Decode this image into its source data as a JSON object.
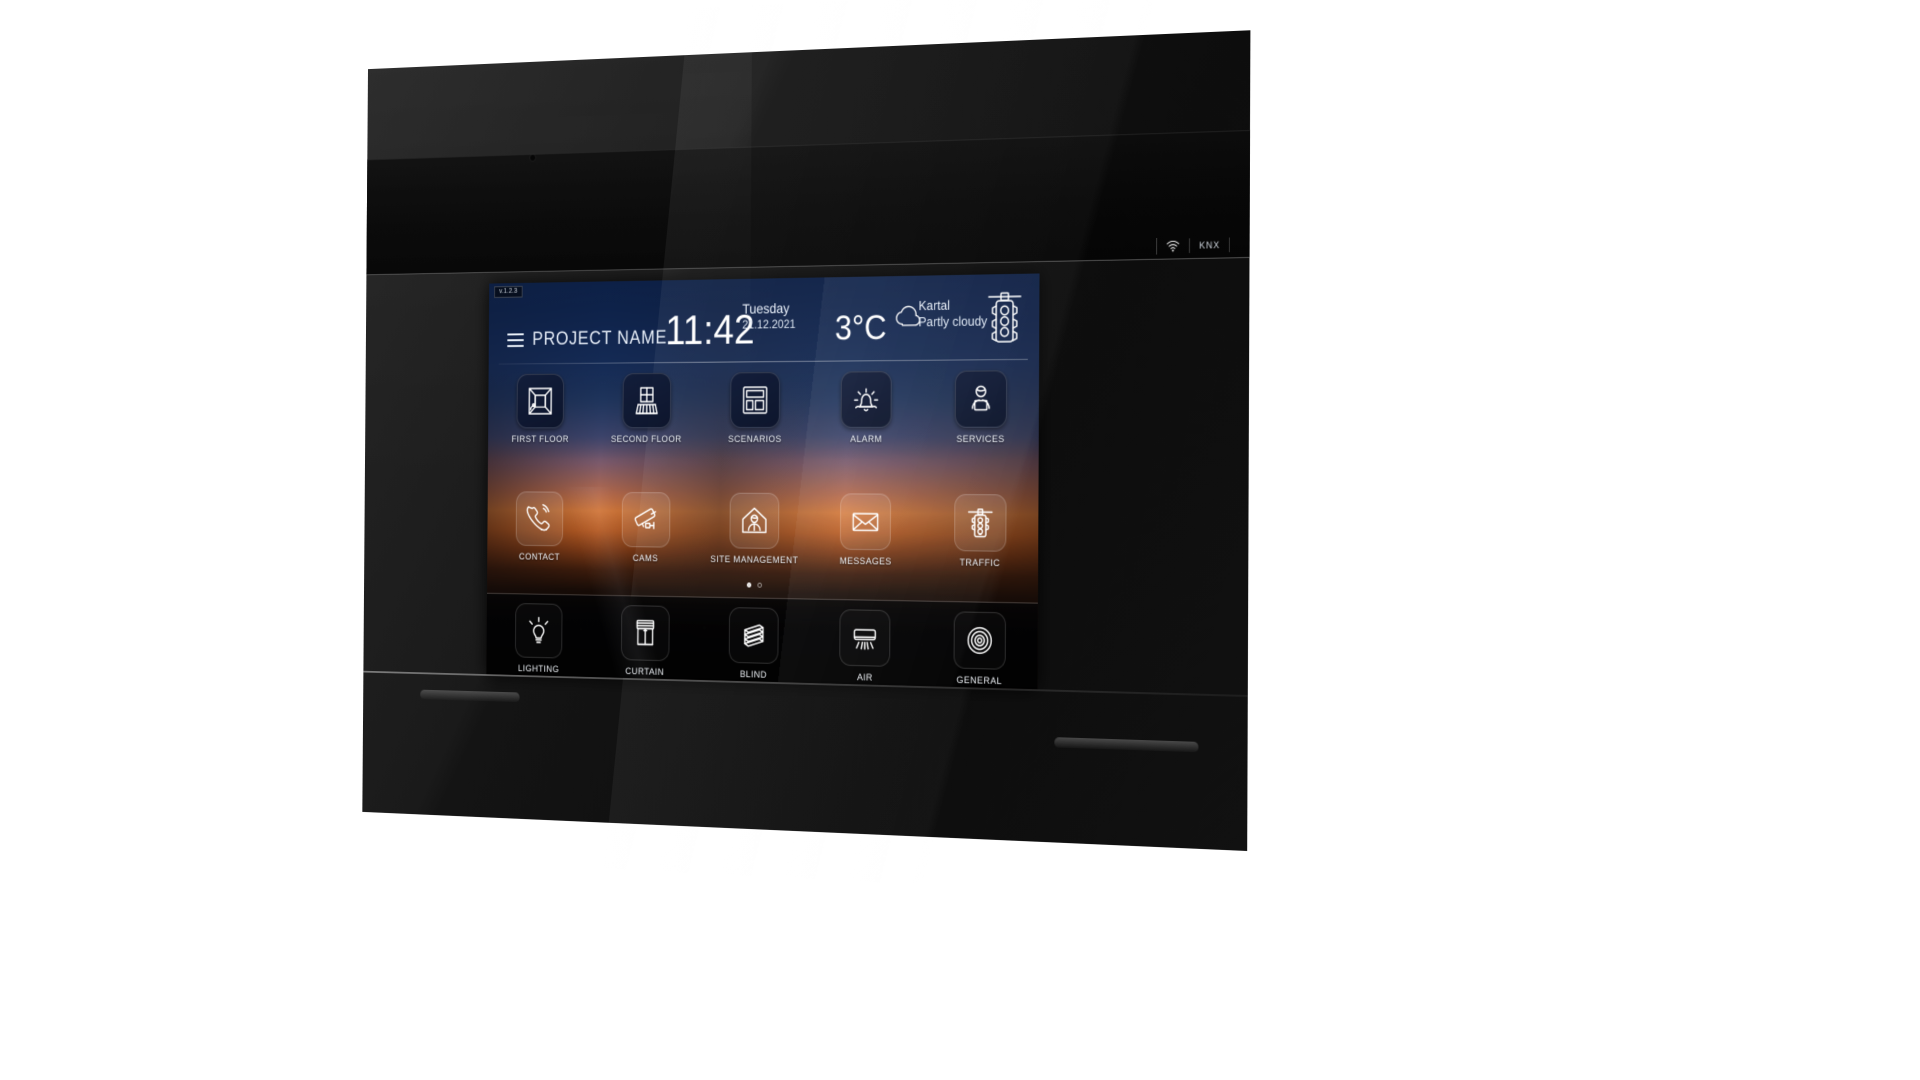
{
  "device": {
    "name": "knx-glass-touch-panel",
    "status_bar": {
      "wifi_icon": "wifi-icon",
      "knx_label": "KNX"
    }
  },
  "screen": {
    "version_badge": "v.1.2.3",
    "header": {
      "menu_icon": "hamburger-menu-icon",
      "project_name": "PROJECT NAME",
      "time": "11:42",
      "day_name": "Tuesday",
      "date": "21.12.2021",
      "temperature": "3°C",
      "weather_icon": "cloud-icon",
      "city": "Kartal",
      "condition": "Partly cloudy",
      "traffic_icon": "traffic-light-icon"
    },
    "pagination": {
      "total": 2,
      "active_index": 0
    },
    "rows": [
      {
        "name": "primary-row",
        "tiles": [
          {
            "label": "FIRST FLOOR",
            "icon": "floor-plan-icon"
          },
          {
            "label": "SECOND FLOOR",
            "icon": "balcony-icon"
          },
          {
            "label": "SCENARIOS",
            "icon": "layout-grid-icon"
          },
          {
            "label": "ALARM",
            "icon": "alarm-bell-icon"
          },
          {
            "label": "SERVICES",
            "icon": "support-agent-icon"
          }
        ]
      },
      {
        "name": "secondary-row",
        "tiles": [
          {
            "label": "CONTACT",
            "icon": "phone-ringing-icon"
          },
          {
            "label": "CAMS",
            "icon": "security-camera-icon"
          },
          {
            "label": "SITE MANAGEMENT",
            "icon": "house-manager-icon"
          },
          {
            "label": "MESSAGES",
            "icon": "envelope-icon"
          },
          {
            "label": "TRAFFIC",
            "icon": "traffic-light-icon"
          }
        ]
      },
      {
        "name": "controls-row",
        "tiles": [
          {
            "label": "LIGHTING",
            "icon": "light-bulb-icon"
          },
          {
            "label": "CURTAIN",
            "icon": "curtain-icon"
          },
          {
            "label": "BLIND",
            "icon": "blind-slats-icon"
          },
          {
            "label": "AIR",
            "icon": "air-conditioner-icon"
          },
          {
            "label": "GENERAL",
            "icon": "concentric-circles-icon"
          }
        ]
      }
    ]
  },
  "colors": {
    "header_blue": "#13264c",
    "sunset_orange": "#d4783a",
    "tile_stroke": "#ffffff",
    "panel_black": "#0d0d0d"
  }
}
